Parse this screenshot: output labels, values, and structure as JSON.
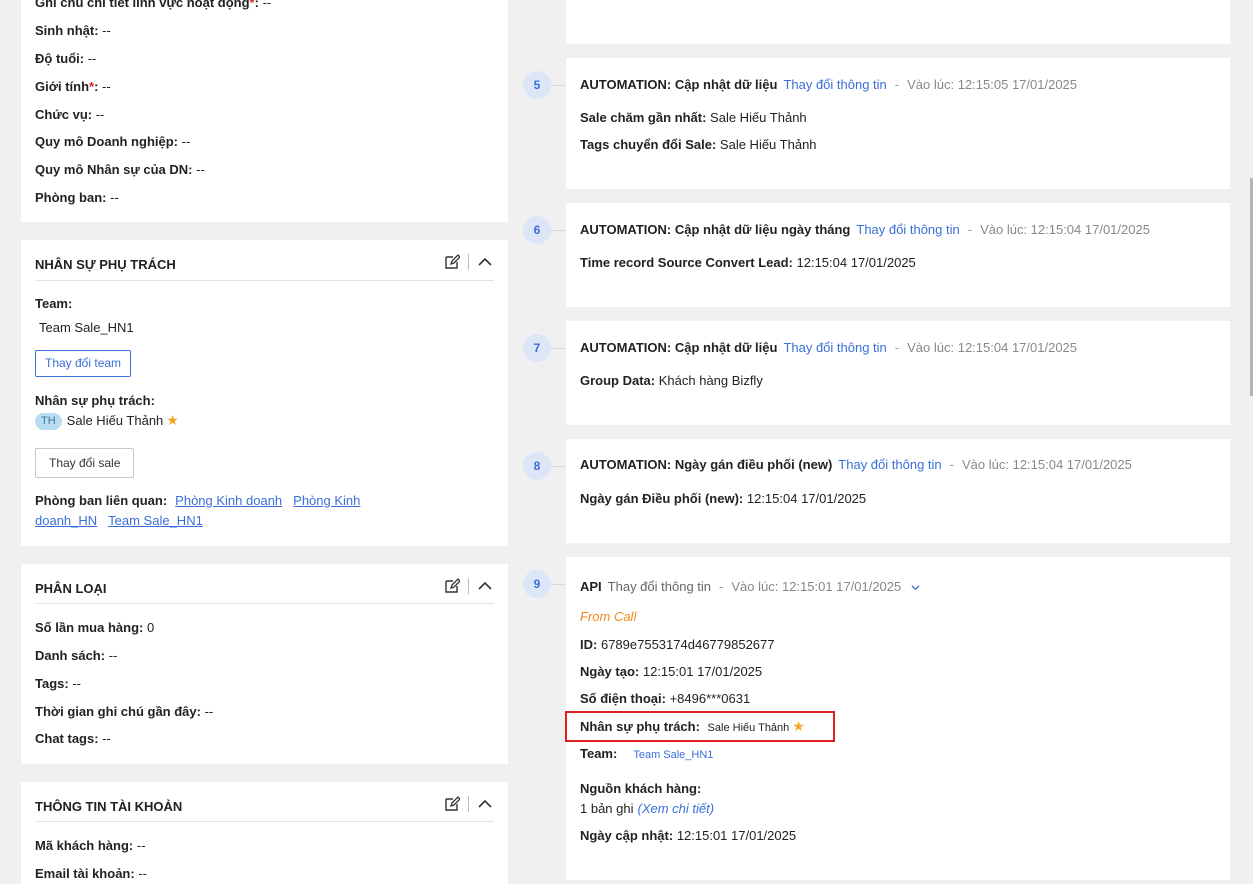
{
  "general": {
    "fields": [
      {
        "label": "Ghi chú chi tiết lĩnh vực hoạt động",
        "required": true,
        "value": "--"
      },
      {
        "label": "Sinh nhật:",
        "required": false,
        "value": "--"
      },
      {
        "label": "Độ tuổi:",
        "required": false,
        "value": "--"
      },
      {
        "label": "Giới tính",
        "required": true,
        "value": "--"
      },
      {
        "label": "Chức vụ:",
        "required": false,
        "value": "--"
      },
      {
        "label": "Quy mô Doanh nghiệp:",
        "required": false,
        "value": "--"
      },
      {
        "label": "Quy mô Nhân sự của DN:",
        "required": false,
        "value": "--"
      },
      {
        "label": "Phòng ban:",
        "required": false,
        "value": "--"
      }
    ]
  },
  "staff": {
    "title": "NHÂN SỰ PHỤ TRÁCH",
    "team_label": "Team:",
    "team_value": "Team Sale_HN1",
    "change_team": "Thay đổi team",
    "owner_label": "Nhân sự phụ trách:",
    "owner_avatar": "TH",
    "owner_name": "Sale Hiếu Thảnh",
    "change_sale": "Thay đổi sale",
    "dept_label": "Phòng ban liên quan:",
    "depts": [
      "Phòng Kinh doanh",
      "Phòng Kinh doanh_HN",
      "Team Sale_HN1"
    ]
  },
  "classify": {
    "title": "PHÂN LOẠI",
    "fields": [
      {
        "label": "Số lần mua hàng:",
        "value": "0"
      },
      {
        "label": "Danh sách:",
        "value": "--"
      },
      {
        "label": "Tags:",
        "value": "--"
      },
      {
        "label": "Thời gian ghi chú gần đây:",
        "value": "--"
      },
      {
        "label": "Chat tags:",
        "value": "--"
      }
    ]
  },
  "account": {
    "title": "THÔNG TIN TÀI KHOẢN",
    "fields": [
      {
        "label": "Mã khách hàng:",
        "value": "--"
      },
      {
        "label": "Email tài khoản:",
        "value": "--"
      }
    ]
  },
  "timeline": [
    {
      "step": "5",
      "action": "AUTOMATION: Cập nhật dữ liệu",
      "change": "Thay đổi thông tin",
      "time": "Vào lúc: 12:15:05 17/01/2025",
      "fields": [
        {
          "label": "Sale chăm gần nhất:",
          "value": "Sale Hiếu Thảnh"
        },
        {
          "label": "Tags chuyển đổi Sale:",
          "value": "Sale Hiếu Thảnh"
        }
      ]
    },
    {
      "step": "6",
      "action": "AUTOMATION: Cập nhật dữ liệu ngày tháng",
      "change": "Thay đổi thông tin",
      "time": "Vào lúc: 12:15:04 17/01/2025",
      "fields": [
        {
          "label": "Time record Source Convert Lead:",
          "value": "12:15:04 17/01/2025"
        }
      ]
    },
    {
      "step": "7",
      "action": "AUTOMATION: Cập nhật dữ liệu",
      "change": "Thay đổi thông tin",
      "time": "Vào lúc: 12:15:04 17/01/2025",
      "fields": [
        {
          "label": "Group Data:",
          "value": "Khách hàng Bizfly"
        }
      ]
    },
    {
      "step": "8",
      "action": "AUTOMATION: Ngày gán điều phối (new)",
      "change": "Thay đổi thông tin",
      "time": "Vào lúc: 12:15:04 17/01/2025",
      "fields": [
        {
          "label": "Ngày gán Điều phối (new):",
          "value": "12:15:04 17/01/2025"
        }
      ]
    }
  ],
  "api_entry": {
    "step": "9",
    "action": "API",
    "change": "Thay đổi thông tin",
    "time": "Vào lúc: 12:15:01 17/01/2025",
    "source": "From Call",
    "id_label": "ID:",
    "id_value": "6789e7553174d46779852677",
    "created_label": "Ngày tạo:",
    "created_value": "12:15:01 17/01/2025",
    "phone_label": "Số điện thoại:",
    "phone_value": "+8496***0631",
    "owner_label": "Nhân sự phụ trách:",
    "owner_value": "Sale Hiếu Thảnh",
    "team_label": "Team:",
    "team_value": "Team Sale_HN1",
    "origin_label": "Nguồn khách hàng:",
    "origin_value": "1 bản ghi",
    "origin_link": "(Xem chi tiết)",
    "updated_label": "Ngày cập nhật:",
    "updated_value": "12:15:01 17/01/2025"
  },
  "colors": {
    "accent": "#3a6fd8",
    "highlight": "#e02020",
    "star": "#f5a623",
    "source": "#f08a1c"
  }
}
